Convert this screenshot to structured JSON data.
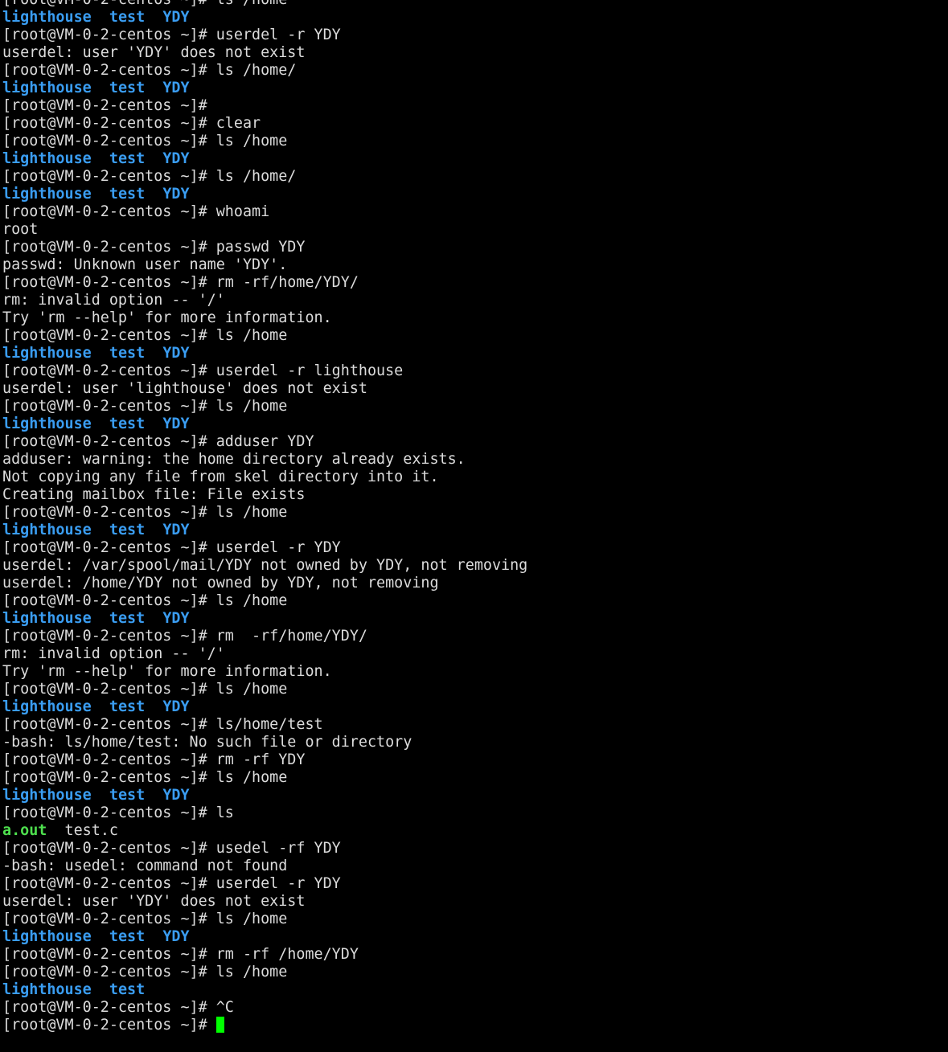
{
  "terminal": {
    "prompt": "[root@VM-0-2-centos ~]# ",
    "colors": {
      "background": "#000000",
      "text": "#dcdcdc",
      "directory": "#3a9df2",
      "executable": "#4ee04e",
      "cursor": "#00ff00"
    },
    "lines": [
      {
        "cmd": "ls /home"
      },
      {
        "ls": [
          {
            "name": "lighthouse",
            "type": "dir"
          },
          {
            "name": "test",
            "type": "dir"
          },
          {
            "name": "YDY",
            "type": "dir"
          }
        ]
      },
      {
        "cmd": "userdel -r YDY"
      },
      {
        "out": "userdel: user 'YDY' does not exist"
      },
      {
        "cmd": "ls /home/"
      },
      {
        "ls": [
          {
            "name": "lighthouse",
            "type": "dir"
          },
          {
            "name": "test",
            "type": "dir"
          },
          {
            "name": "YDY",
            "type": "dir"
          }
        ]
      },
      {
        "cmd": ""
      },
      {
        "cmd": "clear"
      },
      {
        "cmd": "ls /home"
      },
      {
        "ls": [
          {
            "name": "lighthouse",
            "type": "dir"
          },
          {
            "name": "test",
            "type": "dir"
          },
          {
            "name": "YDY",
            "type": "dir"
          }
        ]
      },
      {
        "cmd": "ls /home/"
      },
      {
        "ls": [
          {
            "name": "lighthouse",
            "type": "dir"
          },
          {
            "name": "test",
            "type": "dir"
          },
          {
            "name": "YDY",
            "type": "dir"
          }
        ]
      },
      {
        "cmd": "whoami"
      },
      {
        "out": "root"
      },
      {
        "cmd": "passwd YDY"
      },
      {
        "out": "passwd: Unknown user name 'YDY'."
      },
      {
        "cmd": "rm -rf/home/YDY/"
      },
      {
        "out": "rm: invalid option -- '/'"
      },
      {
        "out": "Try 'rm --help' for more information."
      },
      {
        "cmd": "ls /home"
      },
      {
        "ls": [
          {
            "name": "lighthouse",
            "type": "dir"
          },
          {
            "name": "test",
            "type": "dir"
          },
          {
            "name": "YDY",
            "type": "dir"
          }
        ]
      },
      {
        "cmd": "userdel -r lighthouse"
      },
      {
        "out": "userdel: user 'lighthouse' does not exist"
      },
      {
        "cmd": "ls /home"
      },
      {
        "ls": [
          {
            "name": "lighthouse",
            "type": "dir"
          },
          {
            "name": "test",
            "type": "dir"
          },
          {
            "name": "YDY",
            "type": "dir"
          }
        ]
      },
      {
        "cmd": "adduser YDY"
      },
      {
        "out": "adduser: warning: the home directory already exists."
      },
      {
        "out": "Not copying any file from skel directory into it."
      },
      {
        "out": "Creating mailbox file: File exists"
      },
      {
        "cmd": "ls /home"
      },
      {
        "ls": [
          {
            "name": "lighthouse",
            "type": "dir"
          },
          {
            "name": "test",
            "type": "dir"
          },
          {
            "name": "YDY",
            "type": "dir"
          }
        ]
      },
      {
        "cmd": "userdel -r YDY"
      },
      {
        "out": "userdel: /var/spool/mail/YDY not owned by YDY, not removing"
      },
      {
        "out": "userdel: /home/YDY not owned by YDY, not removing"
      },
      {
        "cmd": "ls /home"
      },
      {
        "ls": [
          {
            "name": "lighthouse",
            "type": "dir"
          },
          {
            "name": "test",
            "type": "dir"
          },
          {
            "name": "YDY",
            "type": "dir"
          }
        ]
      },
      {
        "cmd": "rm  -rf/home/YDY/"
      },
      {
        "out": "rm: invalid option -- '/'"
      },
      {
        "out": "Try 'rm --help' for more information."
      },
      {
        "cmd": "ls /home"
      },
      {
        "ls": [
          {
            "name": "lighthouse",
            "type": "dir"
          },
          {
            "name": "test",
            "type": "dir"
          },
          {
            "name": "YDY",
            "type": "dir"
          }
        ]
      },
      {
        "cmd": "ls/home/test"
      },
      {
        "out": "-bash: ls/home/test: No such file or directory"
      },
      {
        "cmd": "rm -rf YDY"
      },
      {
        "cmd": "ls /home"
      },
      {
        "ls": [
          {
            "name": "lighthouse",
            "type": "dir"
          },
          {
            "name": "test",
            "type": "dir"
          },
          {
            "name": "YDY",
            "type": "dir"
          }
        ]
      },
      {
        "cmd": "ls"
      },
      {
        "ls": [
          {
            "name": "a.out",
            "type": "exe"
          },
          {
            "name": "test.c",
            "type": "file"
          }
        ]
      },
      {
        "cmd": "usedel -rf YDY"
      },
      {
        "out": "-bash: usedel: command not found"
      },
      {
        "cmd": "userdel -r YDY"
      },
      {
        "out": "userdel: user 'YDY' does not exist"
      },
      {
        "cmd": "ls /home"
      },
      {
        "ls": [
          {
            "name": "lighthouse",
            "type": "dir"
          },
          {
            "name": "test",
            "type": "dir"
          },
          {
            "name": "YDY",
            "type": "dir"
          }
        ]
      },
      {
        "cmd": "rm -rf /home/YDY"
      },
      {
        "cmd": "ls /home"
      },
      {
        "ls": [
          {
            "name": "lighthouse",
            "type": "dir"
          },
          {
            "name": "test",
            "type": "dir"
          }
        ]
      },
      {
        "cmd": "^C"
      },
      {
        "cmd": "",
        "cursor": true
      }
    ]
  }
}
